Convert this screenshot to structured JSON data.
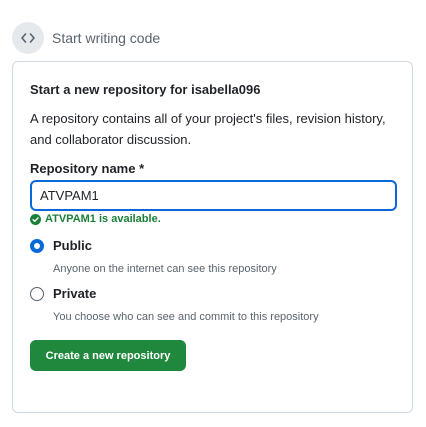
{
  "header": {
    "label": "Start writing code",
    "icon": "code-icon"
  },
  "card": {
    "title": "Start a new repository for isabella096",
    "description": "A repository contains all of your project's files, revision history, and collaborator discussion.",
    "repo_name_label": "Repository name *",
    "repo_name_value": "ATVPAM1",
    "availability_message": "ATVPAM1 is available.",
    "visibility_options": [
      {
        "label": "Public",
        "description": "Anyone on the internet can see this repository",
        "selected": true
      },
      {
        "label": "Private",
        "description": "You choose who can see and commit to this repository",
        "selected": false
      }
    ],
    "create_button_label": "Create a new repository"
  },
  "colors": {
    "accent": "#0969da",
    "success": "#1a7f37",
    "button": "#1f883d"
  }
}
